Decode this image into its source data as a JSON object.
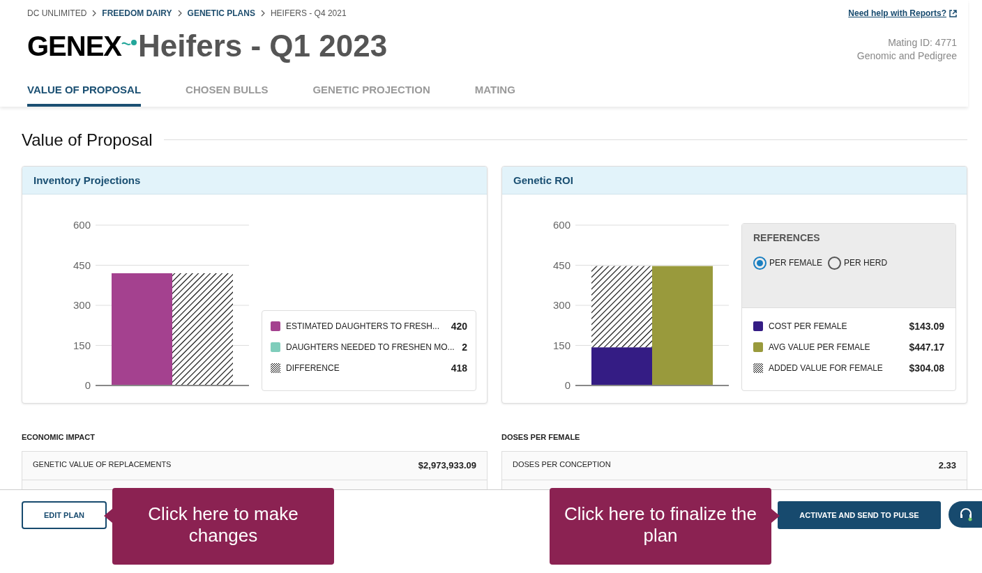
{
  "breadcrumb": [
    {
      "label": "DC UNLIMITED",
      "kind": "plain"
    },
    {
      "label": "FREEDOM DAIRY",
      "kind": "link"
    },
    {
      "label": "GENETIC PLANS",
      "kind": "link"
    },
    {
      "label": "HEIFERS - Q4 2021",
      "kind": "plain"
    }
  ],
  "help_link": "Need help with Reports?",
  "logo": "GENEX",
  "title": "Heifers - Q1 2023",
  "mating_id": "Mating ID: 4771",
  "mating_type": "Genomic and Pedigree",
  "tabs": [
    {
      "label": "VALUE OF PROPOSAL",
      "selected": true
    },
    {
      "label": "CHOSEN BULLS",
      "selected": false
    },
    {
      "label": "GENETIC PROJECTION",
      "selected": false
    },
    {
      "label": "MATING",
      "selected": false
    }
  ],
  "section_title": "Value of Proposal",
  "inventory": {
    "title": "Inventory Projections",
    "legend": [
      {
        "value": "420",
        "kind": "solid"
      },
      {
        "value": "2",
        "kind": "solid"
      },
      {
        "value": "418",
        "kind": "hatch"
      }
    ],
    "chart_data": {
      "type": "bar",
      "stacked": true,
      "grid": true,
      "ylim": [
        0,
        600
      ],
      "yticks": [
        0,
        150,
        300,
        450,
        600
      ],
      "series": [
        {
          "name": "ESTIMATED DAUGHTERS TO FRESH...",
          "color": "#a4418f",
          "values": [
            420,
            null
          ]
        },
        {
          "name": "DAUGHTERS NEEDED TO FRESHEN MO...",
          "color": "#7fcdbb",
          "values": [
            null,
            2
          ]
        },
        {
          "name": "DIFFERENCE",
          "color": "#000000",
          "values": [
            null,
            418
          ]
        }
      ]
    }
  },
  "roi": {
    "title": "Genetic ROI",
    "references_title": "REFERENCES",
    "options": [
      {
        "label": "PER FEMALE",
        "selected": true
      },
      {
        "label": "PER HERD",
        "selected": false
      }
    ],
    "legend": [
      {
        "value": "$143.09",
        "kind": "solid"
      },
      {
        "value": "$447.17",
        "kind": "solid"
      },
      {
        "value": "$304.08",
        "kind": "hatch"
      }
    ],
    "chart_data": {
      "type": "bar",
      "stacked": true,
      "grid": true,
      "ylim": [
        0,
        600
      ],
      "yticks": [
        0,
        150,
        300,
        450,
        600
      ],
      "series": [
        {
          "name": "COST PER FEMALE",
          "color": "#341c84",
          "values": [
            143,
            null
          ]
        },
        {
          "name": "AVG VALUE PER FEMALE",
          "color": "#999a3c",
          "values": [
            null,
            447
          ]
        },
        {
          "name": "ADDED VALUE FOR FEMALE",
          "color": "#000000",
          "values": [
            304,
            null
          ]
        }
      ]
    }
  },
  "tables": [
    {
      "title": "ECONOMIC IMPACT",
      "rows": [
        {
          "label": "GENETIC VALUE OF REPLACEMENTS",
          "value": "$2,973,933.09"
        }
      ]
    },
    {
      "title": "DOSES PER FEMALE",
      "rows": [
        {
          "label": "DOSES PER CONCEPTION",
          "value": "2.33"
        }
      ]
    }
  ],
  "footer": {
    "edit_button": "EDIT PLAN",
    "activate_button": "ACTIVATE AND SEND TO PULSE"
  },
  "callouts": [
    {
      "text": "Click here to make changes"
    },
    {
      "text": "Click here to finalize the plan"
    }
  ]
}
